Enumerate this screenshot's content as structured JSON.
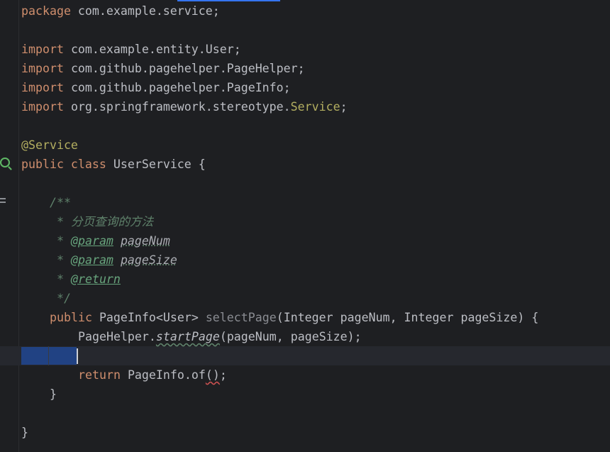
{
  "code": {
    "line1": {
      "kw": "package",
      "rest": " com.example.service;"
    },
    "line2": {
      "kw": "import",
      "rest": " com.example.entity.User;"
    },
    "line3": {
      "kw": "import",
      "rest": " com.github.pagehelper.PageHelper;"
    },
    "line4": {
      "kw": "import",
      "rest": " com.github.pagehelper.PageInfo;"
    },
    "line5": {
      "kw": "import",
      "pre": " org.springframework.stereotype.",
      "hl": "Service",
      "post": ";"
    },
    "line6": {
      "ann": "@Service"
    },
    "line7": {
      "kw": "public class",
      "rest": " UserService {"
    },
    "doc1": "/**",
    "doc2": " * 分页查询的方法",
    "doc3": {
      "star": " * ",
      "tag": "@param",
      "sp": " ",
      "param": "pageNum"
    },
    "doc4": {
      "star": " * ",
      "tag": "@param",
      "sp": " ",
      "param": "pageSize"
    },
    "doc5": {
      "star": " * ",
      "tag": "@return"
    },
    "doc6": " */",
    "method": {
      "kw": "public",
      "type": " PageInfo<User> ",
      "name": "selectPage",
      "params": "(Integer pageNum, Integer pageSize) {"
    },
    "call": {
      "cls": "PageHelper.",
      "name": "startPage",
      "args": "(pageNum, pageSize);"
    },
    "ret": {
      "kw": "return",
      "pre": " PageInfo.",
      "name": "of",
      "args": "()",
      "end": ";"
    },
    "close_method": "}",
    "close_class": "}"
  }
}
